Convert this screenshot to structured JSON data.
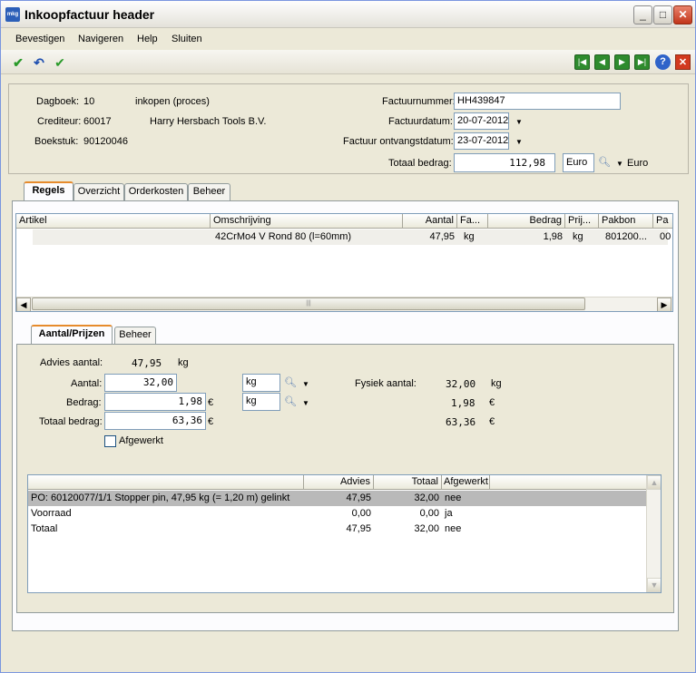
{
  "window": {
    "title": "Inkoopfactuur header",
    "app_icon_text": "mkg"
  },
  "menu": {
    "items": [
      "Bevestigen",
      "Navigeren",
      "Help",
      "Sluiten"
    ]
  },
  "header": {
    "dagboek_label": "Dagboek:",
    "dagboek_code": "10",
    "dagboek_name": "inkopen (proces)",
    "crediteur_label": "Crediteur:",
    "crediteur_code": "60017",
    "crediteur_name": "Harry Hersbach Tools B.V.",
    "boekstuk_label": "Boekstuk:",
    "boekstuk_value": "90120046",
    "factuurnummer_label": "Factuurnummer:",
    "factuurnummer_value": "HH439847",
    "factuurdatum_label": "Factuurdatum:",
    "factuurdatum_value": "20-07-2012",
    "ontvangstdatum_label": "Factuur ontvangstdatum:",
    "ontvangstdatum_value": "23-07-2012",
    "totaal_label": "Totaal bedrag:",
    "totaal_value": "112,98",
    "currency_code": "Euro",
    "currency_name": "Euro"
  },
  "main_tabs": [
    "Regels",
    "Overzicht",
    "Orderkosten",
    "Beheer"
  ],
  "lines_grid": {
    "columns": [
      "Artikel",
      "Omschrijving",
      "Aantal",
      "Fa...",
      "Bedrag",
      "Prij...",
      "Pakbon",
      "Pa"
    ],
    "rows": [
      {
        "artikel": "",
        "omschrijving": "42CrMo4 V Rond 80 (l=60mm)",
        "aantal": "47,95",
        "fa": "kg",
        "bedrag": "1,98",
        "prij": "kg",
        "pakbon": "801200...",
        "pa": "00"
      }
    ]
  },
  "sub_tabs": [
    "Aantal/Prijzen",
    "Beheer"
  ],
  "detail": {
    "advies_label": "Advies aantal:",
    "advies_value": "47,95",
    "advies_unit": "kg",
    "aantal_label": "Aantal:",
    "aantal_value": "32,00",
    "aantal_unit": "kg",
    "bedrag_label": "Bedrag:",
    "bedrag_value": "1,98",
    "bedrag_currency": "€",
    "bedrag_unit": "kg",
    "totaal_label": "Totaal bedrag:",
    "totaal_value": "63,36",
    "totaal_currency": "€",
    "fysiek_label": "Fysiek aantal:",
    "fysiek_value": "32,00",
    "fysiek_unit": "kg",
    "calc_bedrag": "1,98",
    "calc_bedrag_currency": "€",
    "calc_totaal": "63,36",
    "calc_totaal_currency": "€",
    "afgewerkt_label": "Afgewerkt",
    "afgewerkt_checked": false
  },
  "alloc_grid": {
    "columns": [
      "",
      "Advies",
      "Totaal",
      "Afgewerkt"
    ],
    "rows": [
      {
        "desc": "PO: 60120077/1/1 Stopper pin, 47,95 kg (= 1,20 m) gelinkt",
        "advies": "47,95",
        "totaal": "32,00",
        "afgewerkt": "nee"
      },
      {
        "desc": "Voorraad",
        "advies": "0,00",
        "totaal": "0,00",
        "afgewerkt": "ja"
      },
      {
        "desc": "Totaal",
        "advies": "47,95",
        "totaal": "32,00",
        "afgewerkt": "nee"
      }
    ]
  },
  "colors": {
    "selected_row": "#b9b9b9",
    "tab_accent": "#e68b2c",
    "nav_green": "#2e8b2e"
  }
}
